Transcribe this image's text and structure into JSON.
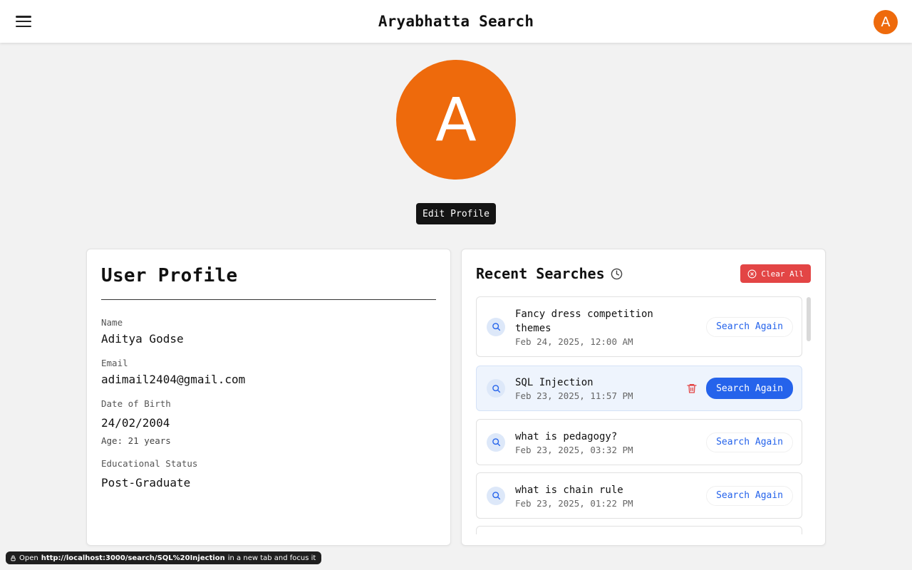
{
  "header": {
    "title": "Aryabhatta Search",
    "avatar_letter": "A",
    "menu_icon": "hamburger-menu-icon"
  },
  "profile": {
    "avatar_letter": "A",
    "avatar_color": "#ee6a0c",
    "edit_label": "Edit Profile",
    "card_title": "User Profile",
    "fields": {
      "name_label": "Name",
      "name_value": "Aditya Godse",
      "email_label": "Email",
      "email_value": "adimail2404@gmail.com",
      "dob_label": "Date of Birth",
      "dob_value": "24/02/2004",
      "age_text": "Age: 21 years",
      "edu_label": "Educational Status",
      "edu_value": "Post-Graduate"
    }
  },
  "recent": {
    "title": "Recent Searches",
    "clear_label": "Clear All",
    "again_label": "Search Again",
    "items": [
      {
        "query": "Fancy dress competition themes",
        "date": "Feb 24, 2025, 12:00 AM"
      },
      {
        "query": "SQL Injection",
        "date": "Feb 23, 2025, 11:57 PM"
      },
      {
        "query": "what is pedagogy?",
        "date": "Feb 23, 2025, 03:32 PM"
      },
      {
        "query": "what is chain rule",
        "date": "Feb 23, 2025, 01:22 PM"
      }
    ]
  },
  "status": {
    "prefix": "Open",
    "url": "http://localhost:3000/search/SQL%20Injection",
    "suffix": "in a new tab and focus it"
  },
  "colors": {
    "accent": "#ee6a0c",
    "primary": "#2563eb",
    "danger": "#e34545"
  }
}
